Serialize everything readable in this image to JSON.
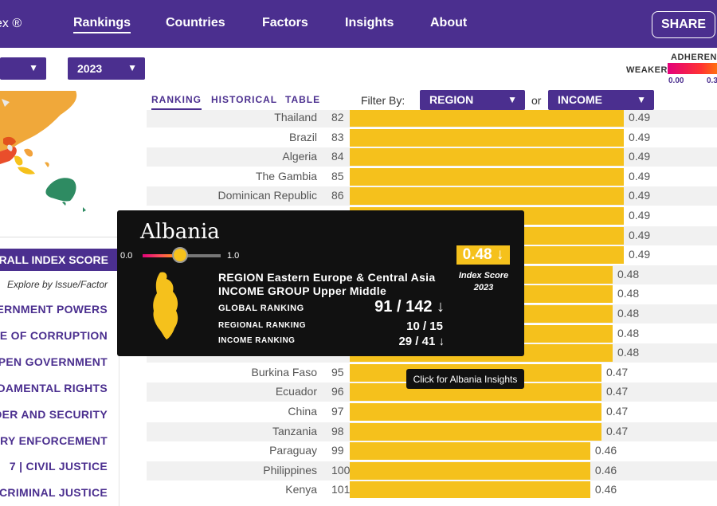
{
  "nav": {
    "brand": "ex ®",
    "links": [
      "Rankings",
      "Countries",
      "Factors",
      "Insights",
      "About"
    ],
    "share": "SHARE"
  },
  "selects": {
    "left": "",
    "year": "2023",
    "region": "REGION",
    "income": "INCOME"
  },
  "legend": {
    "adherence": "ADHEREN",
    "weaker": "WEAKER",
    "min": "0.00",
    "next": "0.3"
  },
  "tabs": [
    "RANKING",
    "HISTORICAL",
    "TABLE"
  ],
  "filter_by": "Filter By:",
  "or": "or",
  "factors": {
    "overall": "RALL INDEX SCORE",
    "explore": "Explore by Issue/Factor",
    "items": [
      "ERNMENT POWERS",
      "CE OF CORRUPTION",
      "OPEN GOVERNMENT",
      "DAMENTAL RIGHTS",
      "DER AND SECURITY",
      "ORY ENFORCEMENT",
      "7 | CIVIL JUSTICE",
      "CRIMINAL JUSTICE"
    ]
  },
  "rows": [
    {
      "country": "Thailand",
      "rank": "82",
      "score": "0.49",
      "value": 0.49
    },
    {
      "country": "Brazil",
      "rank": "83",
      "score": "0.49",
      "value": 0.49
    },
    {
      "country": "Algeria",
      "rank": "84",
      "score": "0.49",
      "value": 0.49
    },
    {
      "country": "The Gambia",
      "rank": "85",
      "score": "0.49",
      "value": 0.49
    },
    {
      "country": "Dominican Republic",
      "rank": "86",
      "score": "0.49",
      "value": 0.49
    },
    {
      "country": "",
      "rank": "",
      "score": "0.49",
      "value": 0.49
    },
    {
      "country": "",
      "rank": "",
      "score": "0.49",
      "value": 0.49
    },
    {
      "country": "",
      "rank": "",
      "score": "0.49",
      "value": 0.49
    },
    {
      "country": "",
      "rank": "",
      "score": "0.48",
      "value": 0.48
    },
    {
      "country": "",
      "rank": "",
      "score": "0.48",
      "value": 0.48
    },
    {
      "country": "",
      "rank": "",
      "score": "0.48",
      "value": 0.48
    },
    {
      "country": "",
      "rank": "",
      "score": "0.48",
      "value": 0.48
    },
    {
      "country": "",
      "rank": "",
      "score": "0.48",
      "value": 0.48
    },
    {
      "country": "Burkina Faso",
      "rank": "95",
      "score": "0.47",
      "value": 0.47
    },
    {
      "country": "Ecuador",
      "rank": "96",
      "score": "0.47",
      "value": 0.47
    },
    {
      "country": "China",
      "rank": "97",
      "score": "0.47",
      "value": 0.47
    },
    {
      "country": "Tanzania",
      "rank": "98",
      "score": "0.47",
      "value": 0.47
    },
    {
      "country": "Paraguay",
      "rank": "99",
      "score": "0.46",
      "value": 0.46
    },
    {
      "country": "Philippines",
      "rank": "100",
      "score": "0.46",
      "value": 0.46
    },
    {
      "country": "Kenya",
      "rank": "101",
      "score": "0.46",
      "value": 0.46
    }
  ],
  "tooltip": {
    "name": "Albania",
    "slider_min": "0.0",
    "slider_max": "1.0",
    "slider_value": 0.48,
    "region": "REGION Eastern Europe & Central Asia",
    "income": "INCOME GROUP Upper Middle",
    "global_label": "GLOBAL RANKING",
    "global_value": "91 / 142 ↓",
    "regional_label": "REGIONAL RANKING",
    "regional_value": "10 / 15",
    "income_label": "INCOME RANKING",
    "income_value": "29 / 41 ↓",
    "score": "0.48 ↓",
    "score_label": "Index Score",
    "year": "2023"
  },
  "insights_tip": "Click for Albania Insights",
  "colors": {
    "purple": "#4b2f8f",
    "bar": "#f5c11c",
    "accent": "#e3007b"
  }
}
